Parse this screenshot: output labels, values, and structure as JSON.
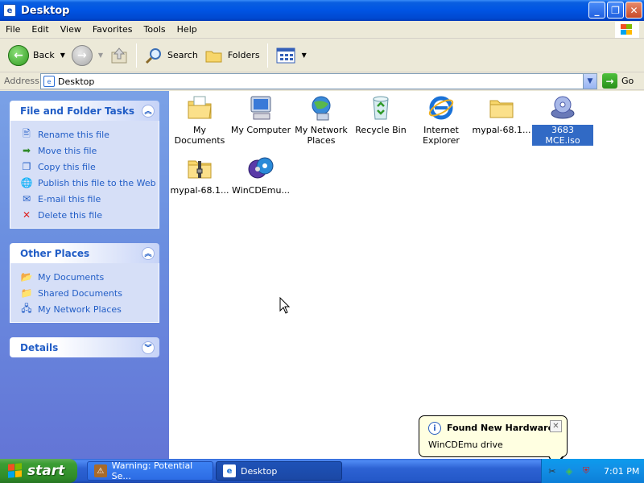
{
  "window": {
    "title": "Desktop",
    "buttons": {
      "minimize": "_",
      "maximize": "❐",
      "close": "✕"
    }
  },
  "menu": [
    "File",
    "Edit",
    "View",
    "Favorites",
    "Tools",
    "Help"
  ],
  "toolbar": {
    "back": "Back",
    "search": "Search",
    "folders": "Folders"
  },
  "address": {
    "label": "Address",
    "value": "Desktop",
    "go": "Go"
  },
  "tasks_panel": {
    "title": "File and Folder Tasks",
    "items": [
      {
        "label": "Rename this file",
        "icon": "rename-icon"
      },
      {
        "label": "Move this file",
        "icon": "move-icon"
      },
      {
        "label": "Copy this file",
        "icon": "copy-icon"
      },
      {
        "label": "Publish this file to the Web",
        "icon": "publish-web-icon"
      },
      {
        "label": "E-mail this file",
        "icon": "email-icon"
      },
      {
        "label": "Delete this file",
        "icon": "delete-icon"
      }
    ]
  },
  "places_panel": {
    "title": "Other Places",
    "items": [
      {
        "label": "My Documents",
        "icon": "my-documents-icon"
      },
      {
        "label": "Shared Documents",
        "icon": "shared-folder-icon"
      },
      {
        "label": "My Network Places",
        "icon": "network-places-icon"
      }
    ]
  },
  "details_panel": {
    "title": "Details"
  },
  "desktop_items": [
    {
      "label": "My Documents",
      "icon": "my-documents-icon",
      "selected": false
    },
    {
      "label": "My Computer",
      "icon": "my-computer-icon",
      "selected": false
    },
    {
      "label": "My Network Places",
      "icon": "network-places-icon",
      "selected": false
    },
    {
      "label": "Recycle Bin",
      "icon": "recycle-bin-icon",
      "selected": false
    },
    {
      "label": "Internet Explorer",
      "icon": "internet-explorer-icon",
      "selected": false
    },
    {
      "label": "mypal-68.1...",
      "icon": "folder-icon",
      "selected": false
    },
    {
      "label": "3683 MCE.iso",
      "icon": "disc-image-icon",
      "selected": true
    },
    {
      "label": "mypal-68.1...",
      "icon": "zip-folder-icon",
      "selected": false
    },
    {
      "label": "WinCDEmu...",
      "icon": "wincdemu-icon",
      "selected": false
    }
  ],
  "balloon": {
    "title": "Found New Hardware",
    "text": "WinCDEmu drive"
  },
  "taskbar": {
    "start": "start",
    "tasks": [
      {
        "label": "Warning: Potential Se...",
        "icon": "warning-icon"
      },
      {
        "label": "Desktop",
        "icon": "explorer-icon"
      }
    ],
    "clock": "7:01 PM"
  }
}
